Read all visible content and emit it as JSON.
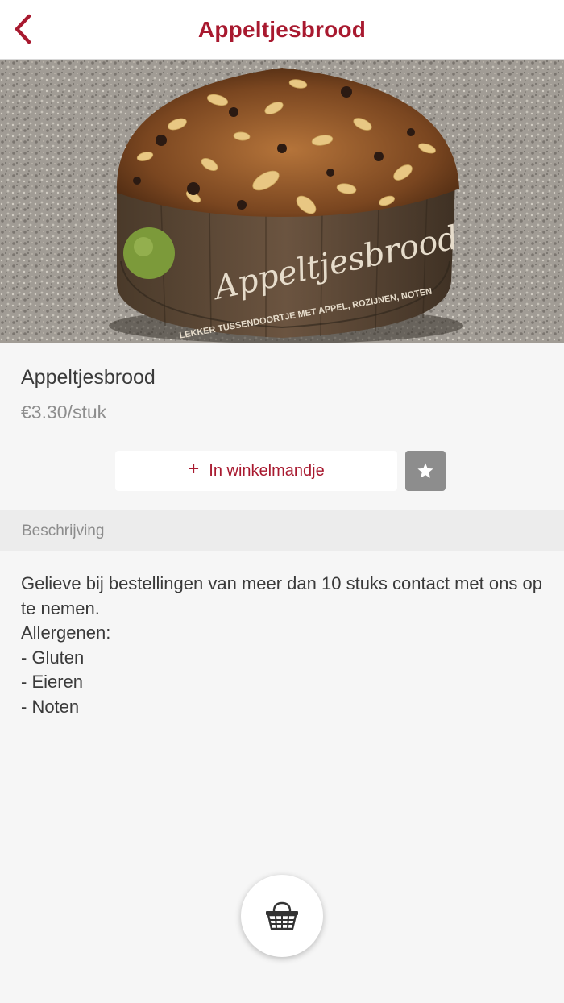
{
  "nav": {
    "title": "Appeltjesbrood",
    "back_icon": "chevron-left-icon",
    "accent_color": "#a8192f"
  },
  "hero": {
    "image_text": "Appeltjesbrood",
    "image_subtext": "LEKKER TUSSENDOORTJE MET APPEL, ROZIJNEN, NOTEN"
  },
  "product": {
    "name": "Appeltjesbrood",
    "price": "€3.30/stuk"
  },
  "actions": {
    "add_to_cart_label": "In winkelmandje",
    "add_icon": "plus-icon",
    "favorite_icon": "star-icon"
  },
  "description": {
    "header": "Beschrijving",
    "lines": [
      "Gelieve bij bestellingen van meer dan 10 stuks contact met ons op te nemen.",
      "Allergenen:",
      "- Gluten",
      "- Eieren",
      "- Noten"
    ]
  },
  "fab": {
    "icon": "basket-icon"
  }
}
